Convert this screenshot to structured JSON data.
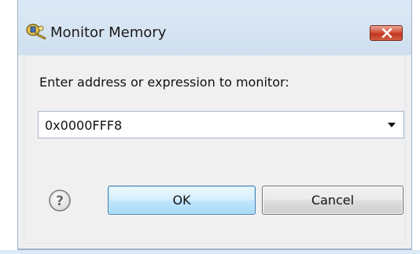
{
  "window": {
    "title": "Monitor Memory",
    "close_label": "Close"
  },
  "form": {
    "prompt": "Enter address or expression to monitor:",
    "address_value": "0x0000FFF8"
  },
  "buttons": {
    "ok_label": "OK",
    "cancel_label": "Cancel"
  },
  "icons": {
    "app": "memory-monitor-icon",
    "help": "help-icon",
    "dropdown": "chevron-down-icon",
    "close": "close-icon"
  },
  "colors": {
    "ok_border": "#3c7fb1",
    "close_red": "#c0351e"
  }
}
